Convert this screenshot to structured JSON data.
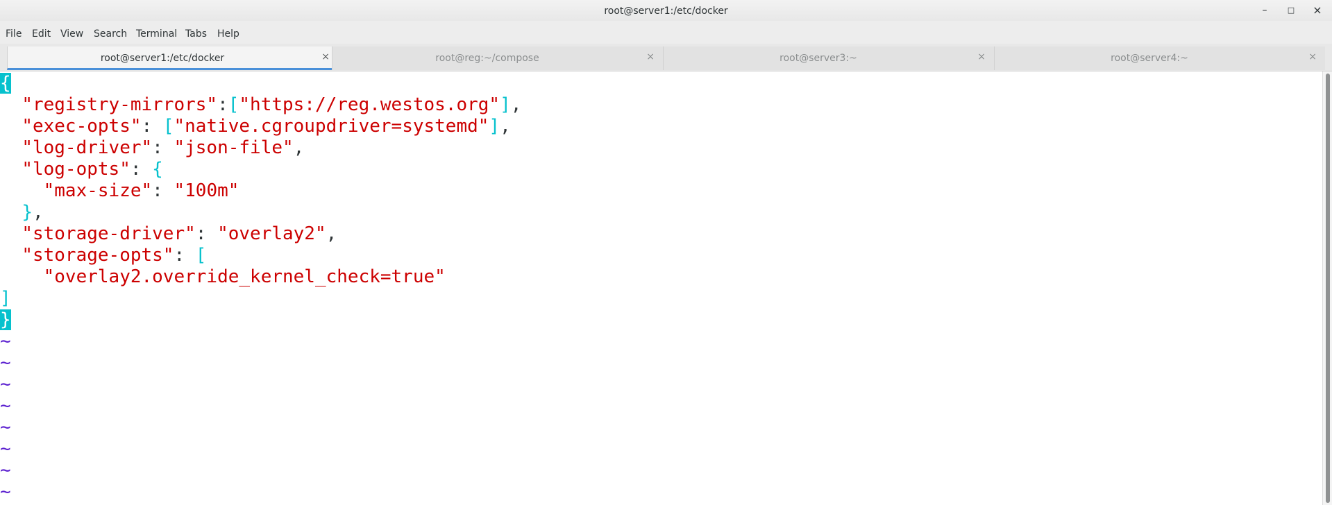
{
  "window": {
    "title": "root@server1:/etc/docker",
    "controls": {
      "minimize": "–",
      "maximize": "□",
      "close": "×"
    }
  },
  "menu": [
    "File",
    "Edit",
    "View",
    "Search",
    "Terminal",
    "Tabs",
    "Help"
  ],
  "tabs": [
    {
      "label": "root@server1:/etc/docker",
      "active": true,
      "close": "×"
    },
    {
      "label": "root@reg:~/compose",
      "active": false,
      "close": "×"
    },
    {
      "label": "root@server3:~",
      "active": false,
      "close": "×"
    },
    {
      "label": "root@server4:~",
      "active": false,
      "close": "×"
    }
  ],
  "editor": {
    "open_brace": "{",
    "registry_mirrors_key": "\"registry-mirrors\"",
    "registry_mirrors_value": "\"https://reg.westos.org\"",
    "exec_opts_key": "\"exec-opts\"",
    "exec_opts_value": "\"native.cgroupdriver=systemd\"",
    "log_driver_key": "\"log-driver\"",
    "log_driver_value": "\"json-file\"",
    "log_opts_key": "\"log-opts\"",
    "max_size_key": "\"max-size\"",
    "max_size_value": "\"100m\"",
    "storage_driver_key": "\"storage-driver\"",
    "storage_driver_value": "\"overlay2\"",
    "storage_opts_key": "\"storage-opts\"",
    "storage_opts_value": "\"overlay2.override_kernel_check=true\"",
    "close_bracket": "]",
    "close_brace": "}",
    "empty_line_marker": "~"
  },
  "colors": {
    "string": "#cc0000",
    "bracket": "#06c1cd",
    "tilde": "#5a1ecf",
    "tab_accent": "#4a90d9"
  }
}
